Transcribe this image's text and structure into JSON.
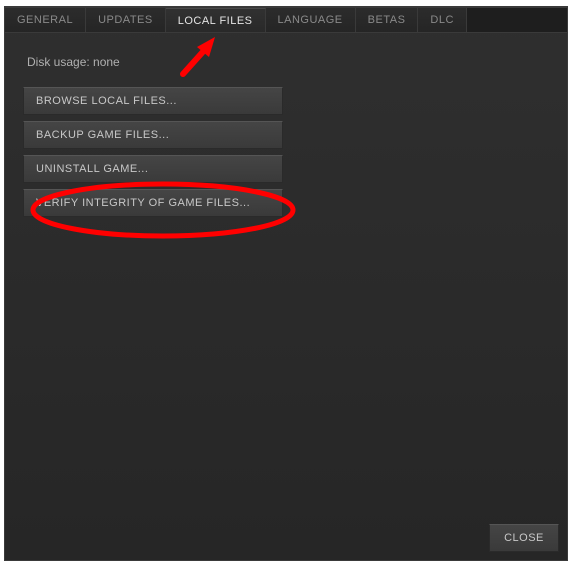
{
  "tabs": {
    "general": "GENERAL",
    "updates": "UPDATES",
    "localfiles": "LOCAL FILES",
    "language": "LANGUAGE",
    "betas": "BETAS",
    "dlc": "DLC"
  },
  "disk_usage_label": "Disk usage: none",
  "buttons": {
    "browse": "BROWSE LOCAL FILES...",
    "backup": "BACKUP GAME FILES...",
    "uninstall": "UNINSTALL GAME...",
    "verify": "VERIFY INTEGRITY OF GAME FILES..."
  },
  "close_label": "CLOSE",
  "annotation": {
    "color": "#ff0000"
  }
}
